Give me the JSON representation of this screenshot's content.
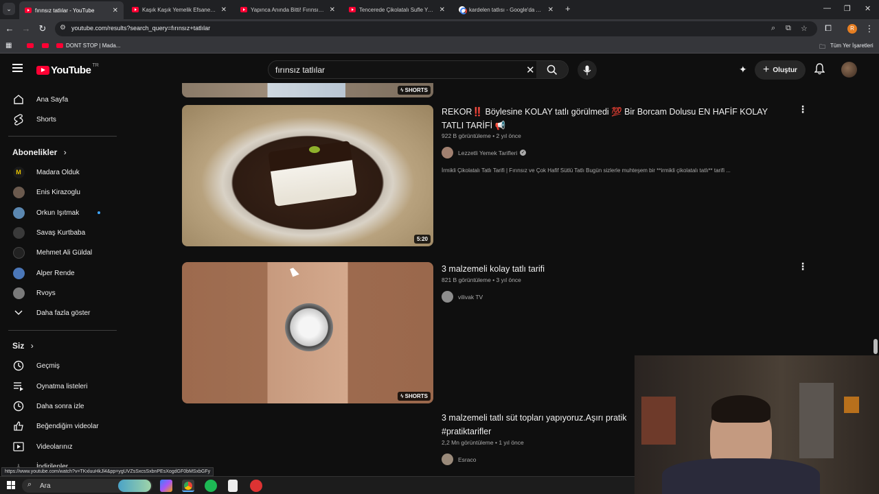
{
  "browser": {
    "tabs": [
      {
        "title": "fırınsız tatlılar - YouTube",
        "active": true
      },
      {
        "title": "Kaşık Kaşık Yemelik Efsane Tatlı",
        "active": false
      },
      {
        "title": "Yapınca Anında Bitti! Fırınsız La",
        "active": false
      },
      {
        "title": "Tencerede Çikolatalı Sufle Yapm",
        "active": false
      },
      {
        "title": "kardelen tatlısı - Google'da Ara",
        "active": false
      }
    ],
    "url": "youtube.com/results?search_query=fırınsız+tatlılar",
    "bookmarks": {
      "item1": "DONT STOP | Mada...",
      "all": "Tüm Yer İşaretleri"
    },
    "profile_initial": "R",
    "status_url": "https://www.youtube.com/watch?v=TKxluuHkJl4&pp=ygUVZsSxcsSxbnPEsXogdGF0bMSxbGFy"
  },
  "youtube": {
    "logo_text": "YouTube",
    "country": "TR",
    "search_value": "fırınsız tatlılar",
    "create_label": "Oluştur",
    "sidebar": {
      "home": "Ana Sayfa",
      "shorts": "Shorts",
      "subs_heading": "Abonelikler",
      "subscriptions": [
        {
          "name": "Madara Olduk",
          "color": "#1a1a1a",
          "initial": "M"
        },
        {
          "name": "Enis Kirazoglu",
          "color": "#6b5a4e"
        },
        {
          "name": "Orkun Işıtmak",
          "color": "#5b87b0",
          "live": true
        },
        {
          "name": "Savaş Kurtbaba",
          "color": "#3a3a3a"
        },
        {
          "name": "Mehmet Ali Güldal",
          "color": "#222222"
        },
        {
          "name": "Alper Rende",
          "color": "#4b77b8"
        },
        {
          "name": "Rvoys",
          "color": "#7a7a7a"
        }
      ],
      "show_more": "Daha fazla göster",
      "you_heading": "Siz",
      "you_items": [
        "Geçmiş",
        "Oynatma listeleri",
        "Daha sonra izle",
        "Beğendiğim videolar",
        "Videolarınız",
        "İndirilenler"
      ]
    },
    "results": [
      {
        "badge": "SHORTS"
      },
      {
        "title_line1": "REKOR‼️ Böylesine KOLAY tatlı görülmedi 💯 Bir Borcam Dolusu EN HAFİF KOLAY",
        "title_line2": "TATLI TARİFİ 📢",
        "views": "922 B görüntüleme",
        "age": "2 yıl önce",
        "channel": "Lezzetli Yemek Tarifleri",
        "verified": true,
        "description": "İrmikli Çikolatalı Tatlı Tarifi | Fırınsız ve Çok Hafif Sütlü Tatlı Bugün sizlerle muhteşem bir **irmikli çikolatalı tatlı** tarifi ...",
        "duration": "5:20"
      },
      {
        "title_line1": "3 malzemeli kolay tatlı tarifi",
        "views": "821 B görüntüleme",
        "age": "3 yıl önce",
        "channel": "vilivak TV",
        "badge": "SHORTS"
      },
      {
        "title_line1": "3 malzemeli tatlı süt topları yapıyoruz.Aşırı pratik",
        "title_line2": "#pratiktarifler",
        "views": "2,2 Mn görüntüleme",
        "age": "1 yıl önce",
        "channel": "Esraco"
      }
    ]
  },
  "taskbar": {
    "search_label": "Ara"
  },
  "colors": {
    "youtube_red": "#ff0033",
    "bg": "#0f0f0f",
    "link_blue": "#3ea6ff"
  }
}
